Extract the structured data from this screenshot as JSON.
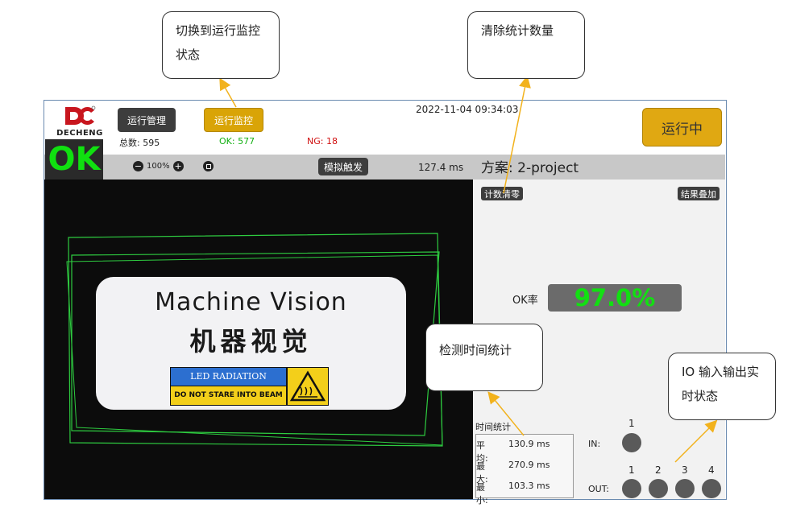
{
  "callouts": {
    "switch_monitor": "切换到运行监控状态",
    "clear_stats": "清除统计数量",
    "detect_time": "检测时间统计",
    "io_status": "IO 输入输出实时状态"
  },
  "header": {
    "logo_text": "DECHENG",
    "btn_management": "运行管理",
    "btn_monitor": "运行监控",
    "datetime": "2022-11-04 09:34:03",
    "btn_running": "运行中",
    "stats": {
      "total_label": "总数:",
      "total_value": "595",
      "ok_label": "OK:",
      "ok_value": "577",
      "ng_label": "NG:",
      "ng_value": "18"
    }
  },
  "toolbar": {
    "result": "OK",
    "zoom_out_icon": "minus",
    "zoom_level": "100%",
    "zoom_in_icon": "plus",
    "fit_icon": "fit-window",
    "btn_simulate": "模拟触发",
    "process_time": "127.4 ms",
    "plan_label": "方案:",
    "plan_name": "2-project"
  },
  "image": {
    "title_en": "Machine Vision",
    "title_cn": "机器视觉",
    "warn_top": "LED RADIATION",
    "warn_bottom": "DO NOT STARE INTO BEAM"
  },
  "panel": {
    "btn_clear": "计数清零",
    "btn_overlay": "结果叠加",
    "ok_rate_label": "OK率",
    "ok_rate_value": "97.0%",
    "time_title": "时间统计",
    "times": [
      {
        "label": "平均:",
        "value": "130.9 ms"
      },
      {
        "label": "最大:",
        "value": "270.9 ms"
      },
      {
        "label": "最小:",
        "value": "103.3 ms"
      }
    ],
    "io": {
      "in_label": "IN:",
      "out_label": "OUT:",
      "in_channels": [
        "1"
      ],
      "out_channels": [
        "1",
        "2",
        "3",
        "4"
      ]
    }
  },
  "colors": {
    "accent_yellow": "#d9a407",
    "ok_green": "#10e010",
    "ng_red": "#e01010",
    "dark_button": "#3d3d3d",
    "box_green": "#2ecc40"
  }
}
